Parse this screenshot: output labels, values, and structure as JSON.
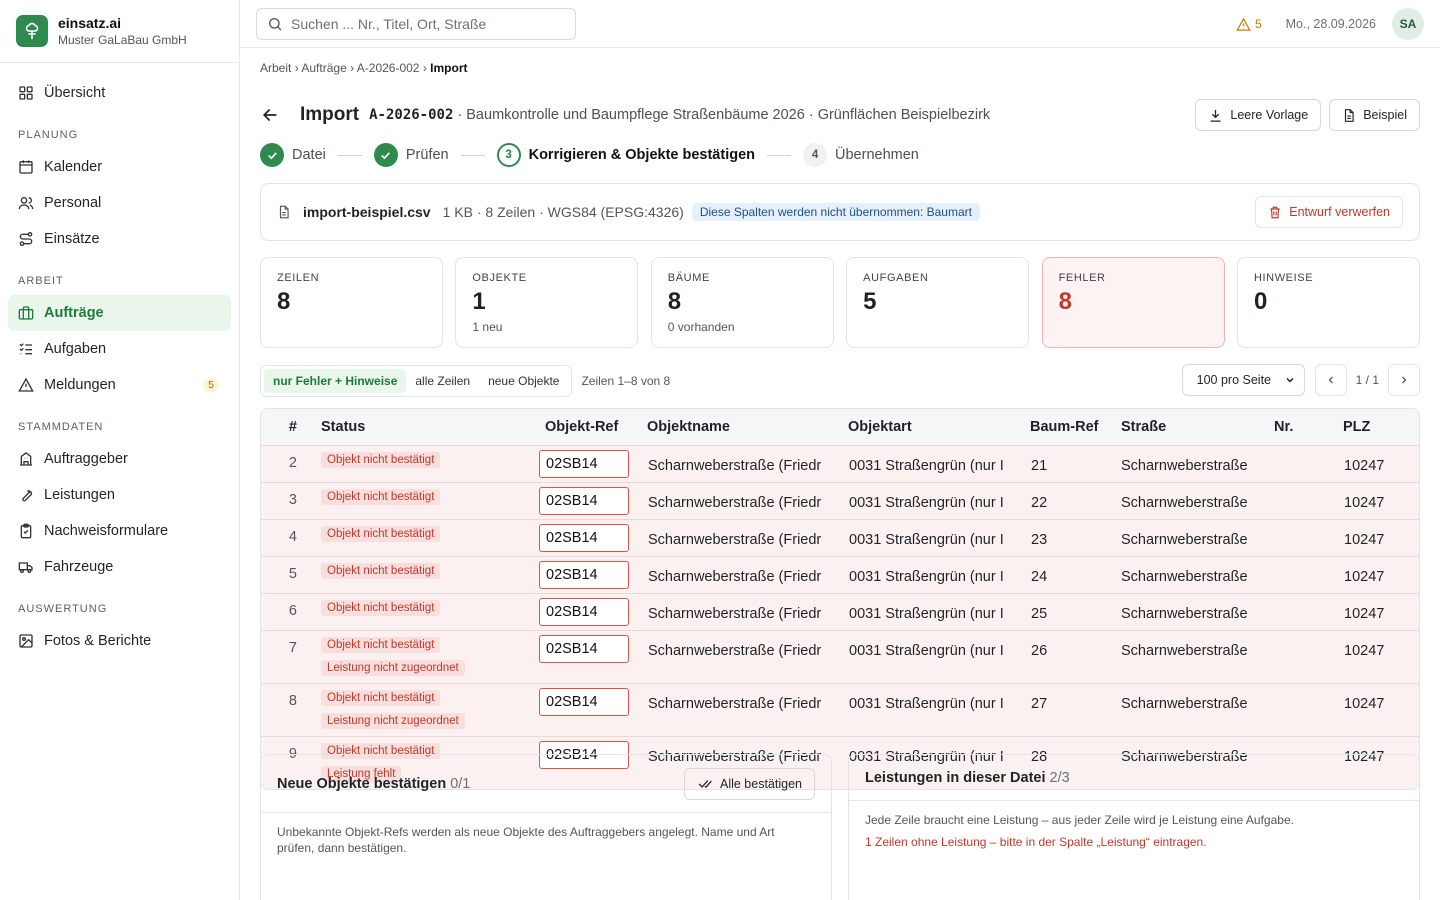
{
  "brand": {
    "name": "einsatz.ai",
    "company": "Muster GaLaBau GmbH"
  },
  "nav": {
    "overview": "Übersicht",
    "sections": {
      "planning": "PLANUNG",
      "work": "ARBEIT",
      "master": "STAMMDATEN",
      "eval": "AUSWERTUNG"
    },
    "calendar": "Kalender",
    "staff": "Personal",
    "deployments": "Einsätze",
    "orders": "Aufträge",
    "tasks": "Aufgaben",
    "reports": "Meldungen",
    "reports_count": "5",
    "clients": "Auftraggeber",
    "services": "Leistungen",
    "forms": "Nachweisformulare",
    "vehicles": "Fahrzeuge",
    "photos": "Fotos & Berichte"
  },
  "topbar": {
    "search_placeholder": "Suchen ... Nr., Titel, Ort, Straße",
    "warnings": "5",
    "date": "Mo., 28.09.2026",
    "avatar": "SA"
  },
  "breadcrumb": {
    "a": "Arbeit",
    "b": "Aufträge",
    "c": "A-2026-002",
    "current": "Import",
    "sep": "›"
  },
  "header": {
    "title": "Import",
    "ref": "A-2026-002",
    "subtitle": "· Baumkontrolle und Baumpflege Straßenbäume 2026 · Grünflächen Beispielbezirk",
    "btn_template": "Leere Vorlage",
    "btn_example": "Beispiel"
  },
  "steps": [
    {
      "num": "",
      "label": "Datei"
    },
    {
      "num": "",
      "label": "Prüfen"
    },
    {
      "num": "3",
      "label": "Korrigieren & Objekte bestätigen"
    },
    {
      "num": "4",
      "label": "Übernehmen"
    }
  ],
  "file": {
    "name": "import-beispiel.csv",
    "meta": "1 KB · 8 Zeilen · WGS84 (EPSG:4326)",
    "pill": "Diese Spalten werden nicht übernommen: Baumart",
    "discard": "Entwurf verwerfen"
  },
  "stats": [
    {
      "label": "ZEILEN",
      "value": "8",
      "sub": ""
    },
    {
      "label": "OBJEKTE",
      "value": "1",
      "sub": "1 neu"
    },
    {
      "label": "BÄUME",
      "value": "8",
      "sub": "0 vorhanden"
    },
    {
      "label": "AUFGABEN",
      "value": "5",
      "sub": ""
    },
    {
      "label": "FEHLER",
      "value": "8",
      "sub": ""
    },
    {
      "label": "HINWEISE",
      "value": "0",
      "sub": ""
    }
  ],
  "filters": {
    "errors": "nur Fehler + Hinweise",
    "all": "alle Zeilen",
    "new": "neue Objekte",
    "rows_info": "Zeilen 1–8 von 8",
    "per_page": "100 pro Seite",
    "page": "1 / 1"
  },
  "table": {
    "headers": {
      "num": "#",
      "status": "Status",
      "ref": "Objekt-Ref",
      "name": "Objektname",
      "type": "Objektart",
      "tree": "Baum-Ref",
      "street": "Straße",
      "nr": "Nr.",
      "plz": "PLZ"
    },
    "rows": [
      {
        "num": "2",
        "s1": "Objekt nicht bestätigt",
        "s2": "",
        "ref": "02SB14",
        "name": "Scharnweberstraße (Friedr",
        "type": "0031 Straßengrün (nur I",
        "tree": "21",
        "street": "Scharnweberstraße",
        "nr": "",
        "plz": "10247"
      },
      {
        "num": "3",
        "s1": "Objekt nicht bestätigt",
        "s2": "",
        "ref": "02SB14",
        "name": "Scharnweberstraße (Friedr",
        "type": "0031 Straßengrün (nur I",
        "tree": "22",
        "street": "Scharnweberstraße",
        "nr": "",
        "plz": "10247"
      },
      {
        "num": "4",
        "s1": "Objekt nicht bestätigt",
        "s2": "",
        "ref": "02SB14",
        "name": "Scharnweberstraße (Friedr",
        "type": "0031 Straßengrün (nur I",
        "tree": "23",
        "street": "Scharnweberstraße",
        "nr": "",
        "plz": "10247"
      },
      {
        "num": "5",
        "s1": "Objekt nicht bestätigt",
        "s2": "",
        "ref": "02SB14",
        "name": "Scharnweberstraße (Friedr",
        "type": "0031 Straßengrün (nur I",
        "tree": "24",
        "street": "Scharnweberstraße",
        "nr": "",
        "plz": "10247"
      },
      {
        "num": "6",
        "s1": "Objekt nicht bestätigt",
        "s2": "",
        "ref": "02SB14",
        "name": "Scharnweberstraße (Friedr",
        "type": "0031 Straßengrün (nur I",
        "tree": "25",
        "street": "Scharnweberstraße",
        "nr": "",
        "plz": "10247"
      },
      {
        "num": "7",
        "s1": "Objekt nicht bestätigt",
        "s2": "Leistung nicht zugeordnet",
        "ref": "02SB14",
        "name": "Scharnweberstraße (Friedr",
        "type": "0031 Straßengrün (nur I",
        "tree": "26",
        "street": "Scharnweberstraße",
        "nr": "",
        "plz": "10247"
      },
      {
        "num": "8",
        "s1": "Objekt nicht bestätigt",
        "s2": "Leistung nicht zugeordnet",
        "ref": "02SB14",
        "name": "Scharnweberstraße (Friedr",
        "type": "0031 Straßengrün (nur I",
        "tree": "27",
        "street": "Scharnweberstraße",
        "nr": "",
        "plz": "10247"
      },
      {
        "num": "9",
        "s1": "Objekt nicht bestätigt",
        "s2": "Leistung fehlt",
        "ref": "02SB14",
        "name": "Scharnweberstraße (Friedr",
        "type": "0031 Straßengrün (nur I",
        "tree": "28",
        "street": "Scharnweberstraße",
        "nr": "",
        "plz": "10247"
      }
    ]
  },
  "panel_objects": {
    "title": "Neue Objekte bestätigen",
    "count": "0/1",
    "button": "Alle bestätigen",
    "text": "Unbekannte Objekt-Refs werden als neue Objekte des Auftraggebers angelegt. Name und Art prüfen, dann bestätigen."
  },
  "panel_services": {
    "title": "Leistungen in dieser Datei",
    "count": "2/3",
    "text": "Jede Zeile braucht eine Leistung – aus jeder Zeile wird je Leistung eine Aufgabe.",
    "error": "1 Zeilen ohne Leistung – bitte in der Spalte „Leistung“ eintragen."
  },
  "colors": {
    "accent": "#2f8a4d",
    "error": "#c0392b",
    "warning": "#c77a00"
  }
}
